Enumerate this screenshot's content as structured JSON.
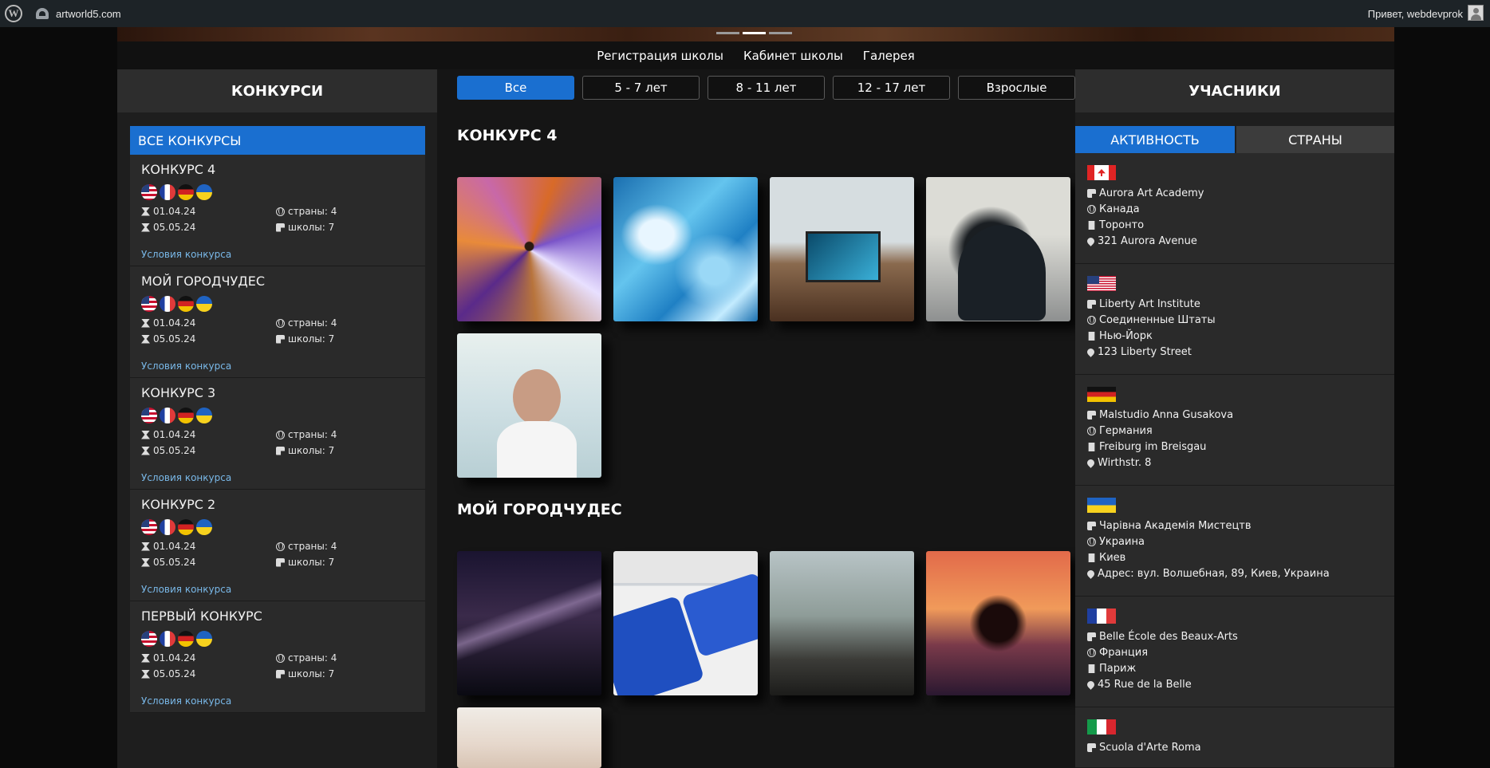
{
  "wp": {
    "site": "artworld5.com",
    "greeting": "Привет, webdevprok"
  },
  "nav": [
    "Регистрация школы",
    "Кабинет школы",
    "Галерея"
  ],
  "left": {
    "title": "КОНКУРСИ",
    "all_label": "ВСЕ КОНКУРСЫ",
    "contests": [
      {
        "title": "КОНКУРС 4",
        "start": "01.04.24",
        "end": "05.05.24",
        "countries": "страны: 4",
        "schools": "школы: 7",
        "link": "Условия конкурса"
      },
      {
        "title": "МОЙ ГОРОДЧУДЕС",
        "start": "01.04.24",
        "end": "05.05.24",
        "countries": "страны: 4",
        "schools": "школы: 7",
        "link": "Условия конкурса"
      },
      {
        "title": "КОНКУРС 3",
        "start": "01.04.24",
        "end": "05.05.24",
        "countries": "страны: 4",
        "schools": "школы: 7",
        "link": "Условия конкурса"
      },
      {
        "title": "КОНКУРС 2",
        "start": "01.04.24",
        "end": "05.05.24",
        "countries": "страны: 4",
        "schools": "школы: 7",
        "link": "Условия конкурса"
      },
      {
        "title": "ПЕРВЫЙ КОНКУРС",
        "start": "01.04.24",
        "end": "05.05.24",
        "countries": "страны: 4",
        "schools": "школы: 7",
        "link": "Условия конкурса"
      }
    ]
  },
  "filters": [
    "Все",
    "5 - 7 лет",
    "8 - 11 лет",
    "12 - 17 лет",
    "Взрослые"
  ],
  "sections": [
    "КОНКУРС 4",
    "МОЙ ГОРОДЧУДЕС"
  ],
  "right": {
    "title": "УЧАСНИКИ",
    "tabs": [
      "АКТИВНОСТЬ",
      "СТРАНЫ"
    ],
    "participants": [
      {
        "flag": "canada-flag",
        "school": "Aurora Art Academy",
        "country": "Канада",
        "city": "Торонто",
        "address": "321 Aurora Avenue"
      },
      {
        "flag": "usa-flag",
        "school": "Liberty Art Institute",
        "country": "Соединенные Штаты",
        "city": "Нью-Йорк",
        "address": "123 Liberty Street"
      },
      {
        "flag": "germany-flag",
        "school": "Malstudio Anna Gusakova",
        "country": "Германия",
        "city": "Freiburg im Breisgau",
        "address": "Wirthstr. 8"
      },
      {
        "flag": "ukraine-flag",
        "school": "Чарівна Академія Мистецтв",
        "country": "Украина",
        "city": "Киев",
        "address": "Адрес: вул. Волшебная, 89, Киев, Украина"
      },
      {
        "flag": "france-flag",
        "school": "Belle École des Beaux-Arts",
        "country": "Франция",
        "city": "Париж",
        "address": "45 Rue de la Belle"
      },
      {
        "flag": "italy-flag",
        "school": "Scuola d'Arte Roma"
      }
    ]
  },
  "colors": {
    "accent": "#1a6fd0",
    "link": "#79b8e8",
    "panel": "#2a2a2a"
  }
}
